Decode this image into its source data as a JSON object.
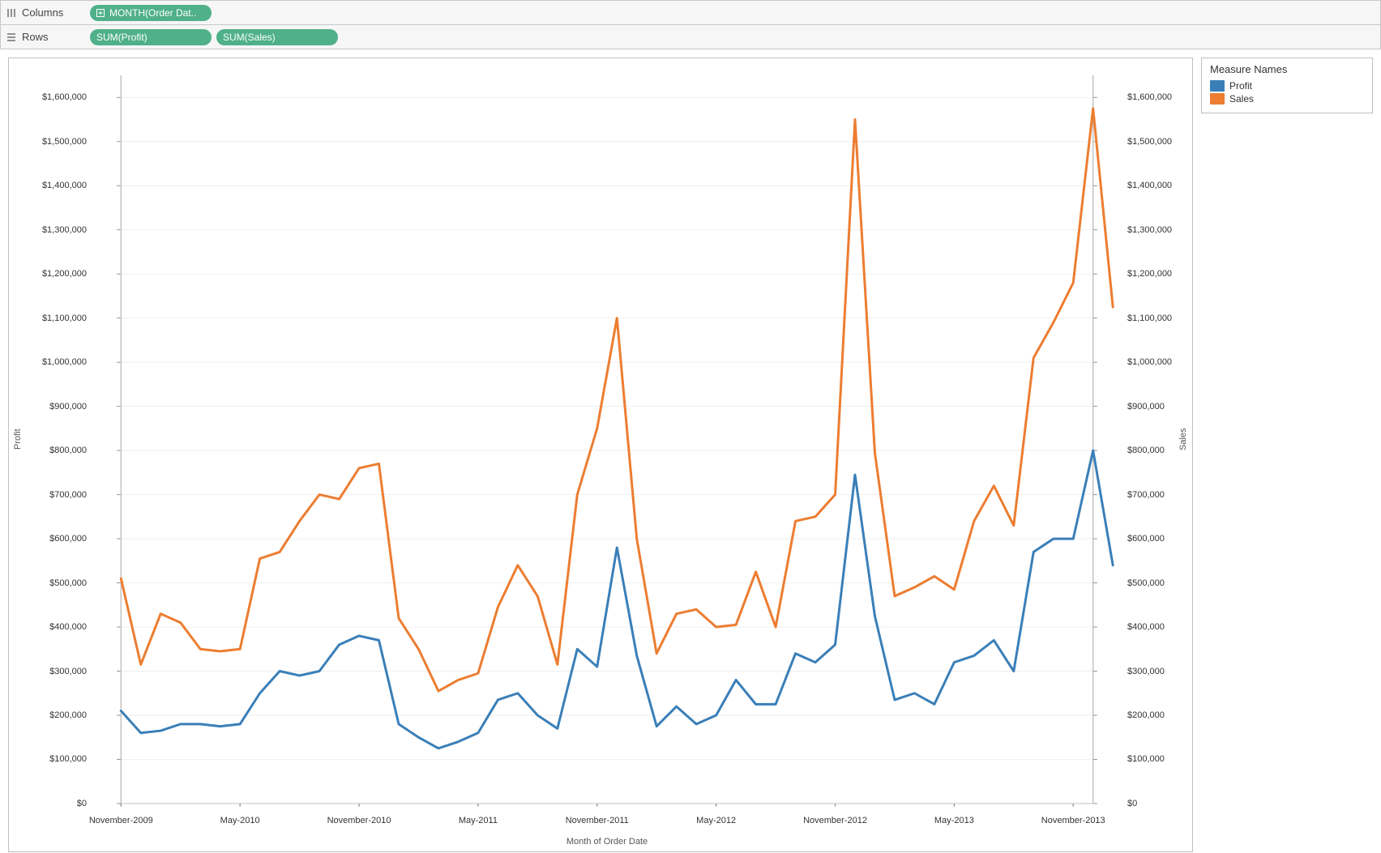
{
  "shelves": {
    "columns_label": "Columns",
    "rows_label": "Rows",
    "columns_pills": [
      {
        "label": "MONTH(Order Dat..",
        "icon": "plus-box"
      }
    ],
    "rows_pills": [
      {
        "label": "SUM(Profit)"
      },
      {
        "label": "SUM(Sales)"
      }
    ]
  },
  "legend": {
    "title": "Measure Names",
    "items": [
      {
        "label": "Profit",
        "color": "#3a7fb8"
      },
      {
        "label": "Sales",
        "color": "#ec7d31"
      }
    ]
  },
  "chart_data": {
    "type": "line",
    "xlabel": "Month of Order Date",
    "y_left_label": "Profit",
    "y_right_label": "Sales",
    "ylim": [
      0,
      1650000
    ],
    "y_tick_values": [
      0,
      100000,
      200000,
      300000,
      400000,
      500000,
      600000,
      700000,
      800000,
      900000,
      1000000,
      1100000,
      1200000,
      1300000,
      1400000,
      1500000,
      1600000
    ],
    "y_tick_labels": [
      "$0",
      "$100,000",
      "$200,000",
      "$300,000",
      "$400,000",
      "$500,000",
      "$600,000",
      "$700,000",
      "$800,000",
      "$900,000",
      "$1,000,000",
      "$1,100,000",
      "$1,200,000",
      "$1,300,000",
      "$1,400,000",
      "$1,500,000",
      "$1,600,000"
    ],
    "x_tick_indices": [
      0,
      6,
      12,
      18,
      24,
      30,
      36,
      42,
      48
    ],
    "x_tick_labels": [
      "November-2009",
      "May-2010",
      "November-2010",
      "May-2011",
      "November-2011",
      "May-2012",
      "November-2012",
      "May-2013",
      "November-2013"
    ],
    "categories": [
      "Nov-2009",
      "Dec-2009",
      "Jan-2010",
      "Feb-2010",
      "Mar-2010",
      "Apr-2010",
      "May-2010",
      "Jun-2010",
      "Jul-2010",
      "Aug-2010",
      "Sep-2010",
      "Oct-2010",
      "Nov-2010",
      "Dec-2010",
      "Jan-2011",
      "Feb-2011",
      "Mar-2011",
      "Apr-2011",
      "May-2011",
      "Jun-2011",
      "Jul-2011",
      "Aug-2011",
      "Sep-2011",
      "Oct-2011",
      "Nov-2011",
      "Dec-2011",
      "Jan-2012",
      "Feb-2012",
      "Mar-2012",
      "Apr-2012",
      "May-2012",
      "Jun-2012",
      "Jul-2012",
      "Aug-2012",
      "Sep-2012",
      "Oct-2012",
      "Nov-2012",
      "Dec-2012",
      "Jan-2013",
      "Feb-2013",
      "Mar-2013",
      "Apr-2013",
      "May-2013",
      "Jun-2013",
      "Jul-2013",
      "Aug-2013",
      "Sep-2013",
      "Oct-2013",
      "Nov-2013",
      "Dec-2013"
    ],
    "series": [
      {
        "name": "Profit",
        "axis": "left",
        "color": "#3a7fb8",
        "values": [
          210000,
          160000,
          165000,
          180000,
          180000,
          175000,
          180000,
          250000,
          300000,
          290000,
          300000,
          360000,
          380000,
          370000,
          180000,
          150000,
          125000,
          140000,
          160000,
          235000,
          250000,
          200000,
          170000,
          350000,
          310000,
          580000,
          335000,
          175000,
          220000,
          180000,
          200000,
          280000,
          225000,
          225000,
          340000,
          320000,
          360000,
          745000,
          425000,
          235000,
          250000,
          225000,
          320000,
          335000,
          370000,
          300000,
          570000,
          600000,
          600000,
          800000,
          540000
        ]
      },
      {
        "name": "Sales",
        "axis": "right",
        "color": "#ec7d31",
        "values": [
          510000,
          315000,
          430000,
          410000,
          350000,
          345000,
          350000,
          555000,
          570000,
          640000,
          700000,
          690000,
          760000,
          770000,
          420000,
          350000,
          255000,
          280000,
          295000,
          445000,
          540000,
          470000,
          315000,
          700000,
          850000,
          1100000,
          600000,
          340000,
          430000,
          440000,
          400000,
          405000,
          525000,
          400000,
          640000,
          650000,
          700000,
          1550000,
          795000,
          470000,
          490000,
          515000,
          485000,
          640000,
          720000,
          630000,
          1010000,
          1090000,
          1180000,
          1575000,
          1125000
        ]
      }
    ]
  }
}
